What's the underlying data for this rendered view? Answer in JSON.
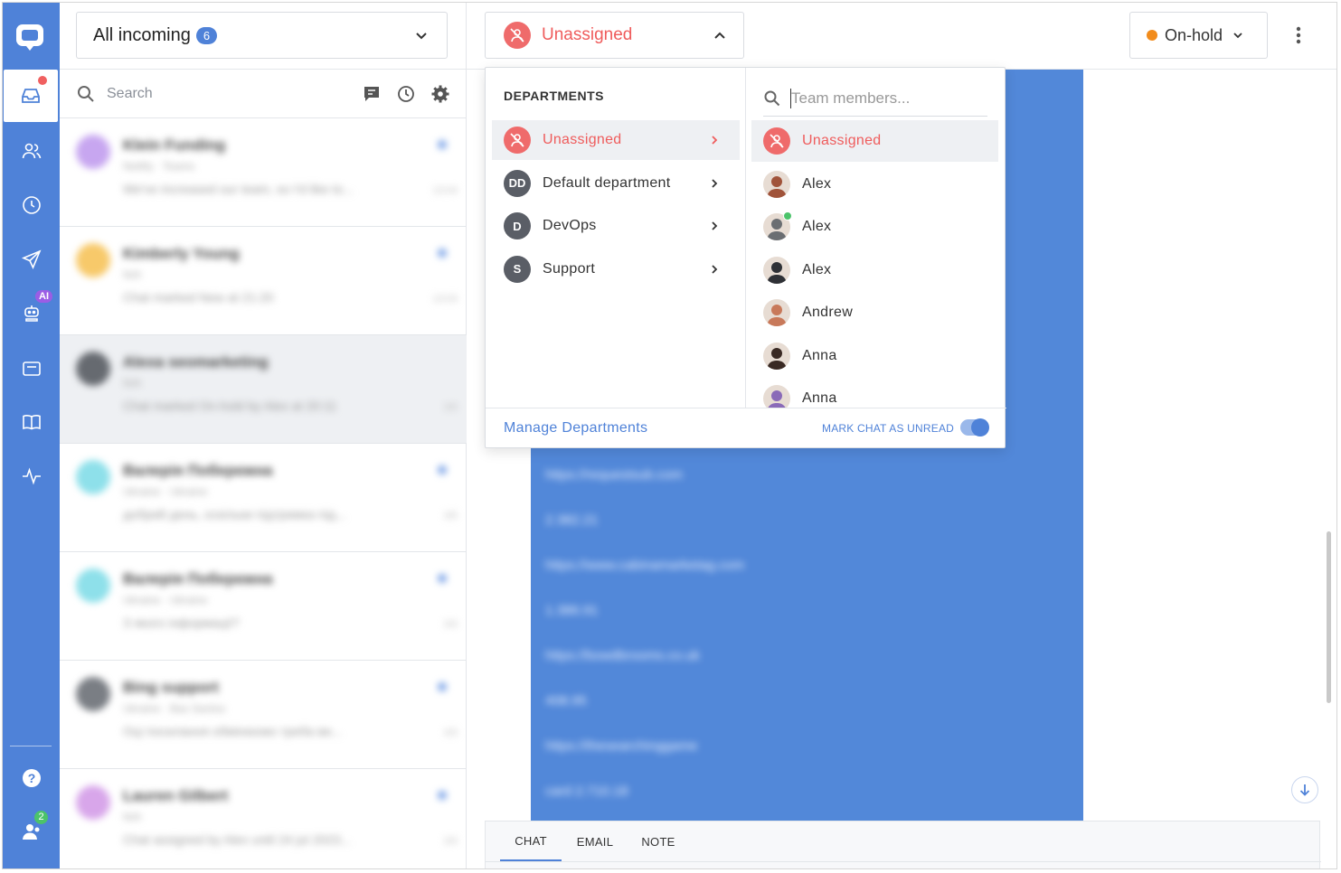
{
  "inbox": {
    "label": "All incoming",
    "count": "6"
  },
  "search": {
    "placeholder": "Search"
  },
  "chats": [
    {
      "name": "Klein Funding",
      "sub": "Netlify · Teams",
      "msg": "We've increased our team, so I'd like to...",
      "time": "13:04",
      "color": "#c7a6f0",
      "selected": false
    },
    {
      "name": "Kimberly Young",
      "sub": "N/A",
      "msg": "Chat marked New at 21:20",
      "time": "13:03",
      "color": "#f7c96a",
      "selected": false
    },
    {
      "name": "Alexa seomarketing",
      "sub": "N/A",
      "msg": "Chat marked On-hold by Alex at 20:11",
      "time": "3/5",
      "color": "#666a70",
      "selected": true
    },
    {
      "name": "Валерія Побережна",
      "sub": "Ukraine · Ukraine",
      "msg": "добрий день, оскільки підтримка під...",
      "time": "3/5",
      "color": "#8ee0ea",
      "selected": false
    },
    {
      "name": "Валерія Побережна",
      "sub": "Ukraine · Ukraine",
      "msg": "З якого інформації?",
      "time": "3/4",
      "color": "#8ee0ea",
      "selected": false
    },
    {
      "name": "Bing support",
      "sub": "Ukraine · Bas Santos",
      "msg": "Оці посилання обмінюємо треба ви...",
      "time": "3/3",
      "color": "#7a7e84",
      "selected": false
    },
    {
      "name": "Lauren Gilbert",
      "sub": "N/A",
      "msg": "Chat assigned by Alex until 24 jul 2023...",
      "time": "3/4",
      "color": "#d8a6ea",
      "selected": false
    }
  ],
  "assign": {
    "label": "Unassigned"
  },
  "status": {
    "label": "On-hold",
    "dot_color": "#f28c1c"
  },
  "dropdown": {
    "departments_title": "DEPARTMENTS",
    "departments": [
      {
        "initials": "",
        "label": "Unassigned",
        "selected": true
      },
      {
        "initials": "DD",
        "label": "Default department",
        "selected": false
      },
      {
        "initials": "D",
        "label": "DevOps",
        "selected": false
      },
      {
        "initials": "S",
        "label": "Support",
        "selected": false
      }
    ],
    "team_placeholder": "Team members...",
    "members": [
      {
        "label": "Unassigned",
        "selected": true,
        "online": false,
        "color": "#ef6b6b"
      },
      {
        "label": "Alex",
        "selected": false,
        "online": false,
        "color": "#a0533a"
      },
      {
        "label": "Alex",
        "selected": false,
        "online": true,
        "color": "#6b6e72"
      },
      {
        "label": "Alex",
        "selected": false,
        "online": false,
        "color": "#2f3136"
      },
      {
        "label": "Andrew",
        "selected": false,
        "online": false,
        "color": "#c8795a"
      },
      {
        "label": "Anna",
        "selected": false,
        "online": false,
        "color": "#3a2a24"
      },
      {
        "label": "Anna",
        "selected": false,
        "online": false,
        "color": "#8a6ab8"
      }
    ],
    "manage_link": "Manage Departments",
    "mark_unread": "MARK CHAT AS UNREAD",
    "mark_unread_on": true
  },
  "blurred_lines": [
    "https://requestsub.com",
    "2.382.21",
    "https://www.cabinamarketag.com",
    "1.386.91",
    "https://bowdbrooms.co.uk",
    "408.95",
    "https://thesearchinggame",
    "card 2.710.18"
  ],
  "compose_tabs": [
    "CHAT",
    "EMAIL",
    "NOTE"
  ],
  "rail": {
    "ai_badge": "AI",
    "team_count": "2"
  },
  "colors": {
    "accent": "#4f82d8",
    "danger": "#ef5c5c",
    "onhold": "#f28c1c",
    "online": "#4cc36a"
  }
}
